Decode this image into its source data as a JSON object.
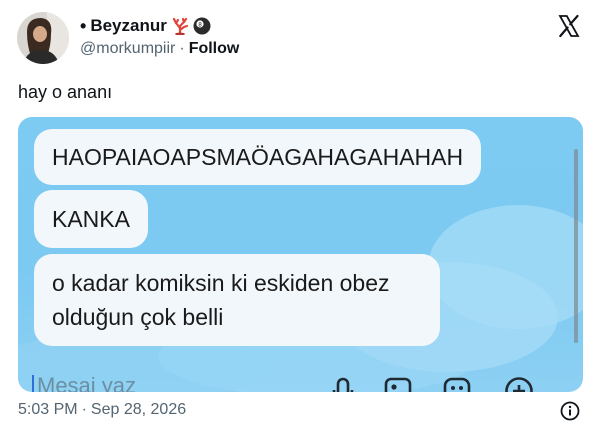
{
  "author": {
    "bullet": "•",
    "display_name": "Beyzanur",
    "handle": "@morkumpiir",
    "separator": "·",
    "follow_label": "Follow",
    "badges": [
      "coral-icon",
      "8-ball-icon"
    ]
  },
  "tweet": {
    "text": "hay o ananı"
  },
  "media": {
    "messages": [
      "HAOPAIAOAPSMAÖAGAHAGAHAHAH",
      "KANKA",
      "o kadar komiksin ki eskiden obez olduğun çok belli"
    ],
    "composer_placeholder": "Mesaj yaz",
    "composer_icons": [
      "microphone-icon",
      "image-icon",
      "emoji-icon",
      "plus-icon"
    ]
  },
  "footer": {
    "time": "5:03 PM",
    "separator": "·",
    "date": "Sep 28, 2026"
  },
  "colors": {
    "text": "#0f1419",
    "secondary": "#536471",
    "chat_background": "#7dcbf2",
    "bubble": "#f2f7fb"
  }
}
